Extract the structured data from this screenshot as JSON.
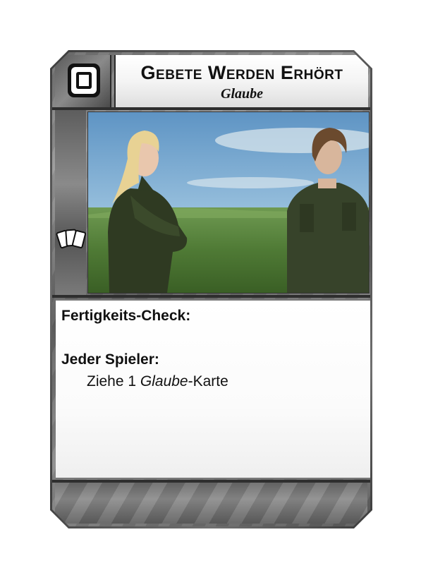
{
  "card": {
    "title": "Gebete Werden Erhört",
    "subtitle": "Glaube",
    "type_icon": "square-frame-icon",
    "side_icon": "playing-cards-icon",
    "artwork": "two-people-in-field-photo",
    "skill_check_label": "Fertigkeits-Check:",
    "players_label": "Jeder Spieler:",
    "effect": {
      "prefix": "Ziehe 1 ",
      "emphasis": "Glaube",
      "suffix": "-Karte"
    }
  },
  "colors": {
    "frame_dark": "#3c3c3c",
    "frame_light": "#9a9a9a",
    "title_panel": "#f4f4f4",
    "text_box": "#ffffff"
  }
}
